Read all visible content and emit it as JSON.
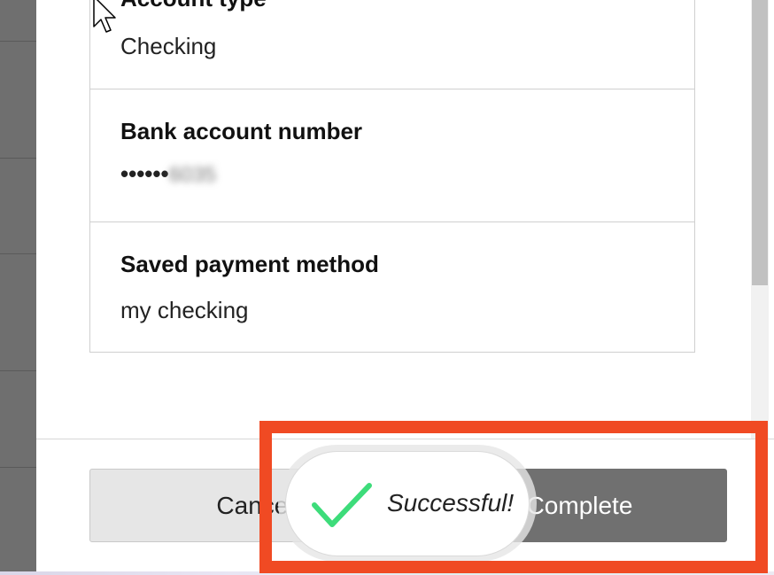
{
  "details": {
    "account_type_label": "Account type",
    "account_type_value": "Checking",
    "account_number_label": "Bank account number",
    "account_number_mask": "••••••",
    "account_number_last4": "6035",
    "saved_method_label": "Saved payment method",
    "saved_method_value": "my checking"
  },
  "footer": {
    "cancel_label": "Cancel",
    "complete_label": "Complete"
  },
  "toast": {
    "message": "Successful!",
    "icon": "checkmark-icon",
    "icon_color": "#3ddc7a"
  },
  "colors": {
    "highlight": "#f04a23",
    "complete_button": "#707070"
  }
}
